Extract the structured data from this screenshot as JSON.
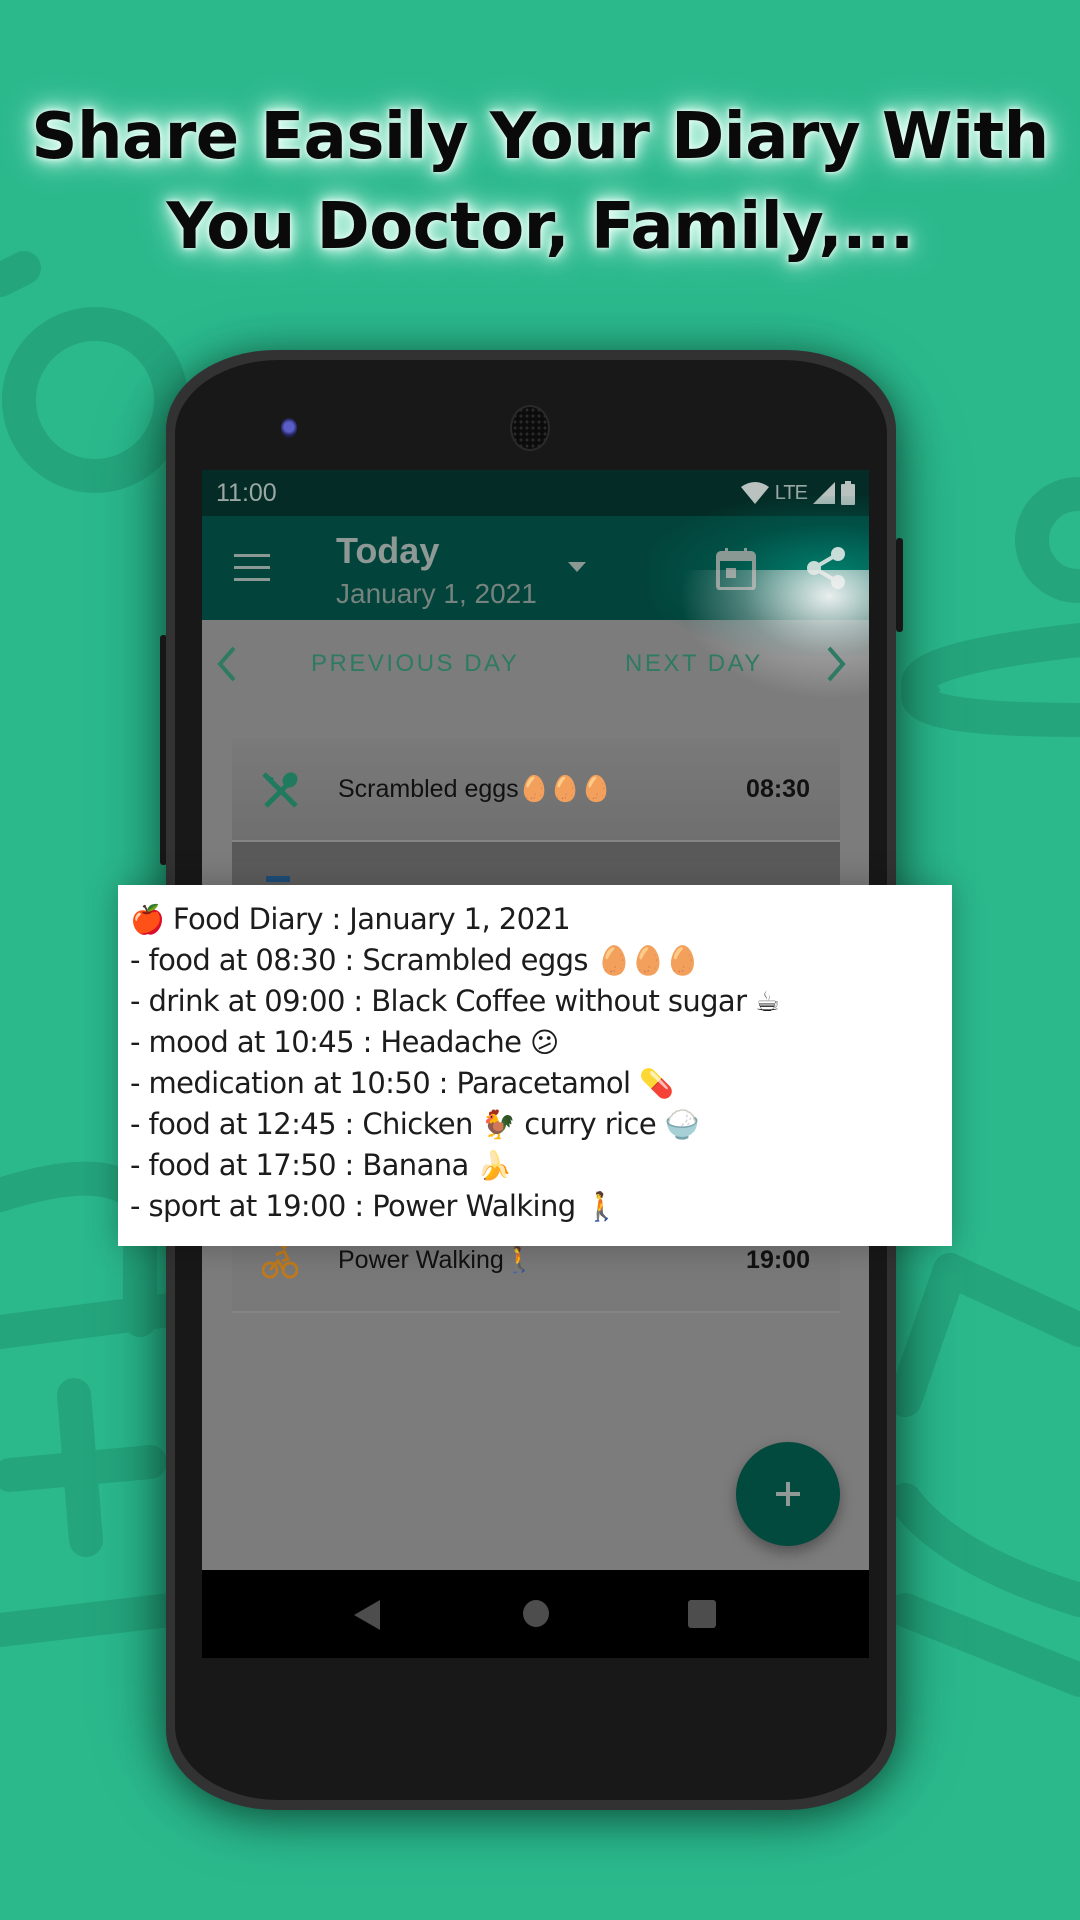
{
  "headline": {
    "line1": "Share Easily Your Diary With",
    "line2": "You Doctor, Family,..."
  },
  "colors": {
    "background": "#2bb98c",
    "app_bar": "#02443b",
    "status_bar": "#042b25",
    "accent_green": "#2e7a63",
    "sport_orange": "#c07a1c",
    "fab": "#024a3d"
  },
  "status_bar": {
    "time": "11:00",
    "network": "LTE",
    "icons": [
      "wifi-icon",
      "lte-signal-icon",
      "battery-icon"
    ]
  },
  "app_bar": {
    "menu_icon": "hamburger-menu-icon",
    "title": "Today",
    "subtitle": "January 1, 2021",
    "dropdown_icon": "dropdown-triangle-icon",
    "actions": [
      "calendar-icon",
      "share-icon"
    ]
  },
  "day_nav": {
    "previous_label": "PREVIOUS DAY",
    "next_label": "NEXT DAY"
  },
  "entries_visible": [
    {
      "icon": "fork-spoon-icon",
      "text": "Scrambled eggs🥚🥚🥚",
      "time": "08:30",
      "category": "food"
    },
    {
      "icon": "fork-spoon-icon",
      "text": "Banana 🍌",
      "time": "17:50",
      "category": "food"
    },
    {
      "icon": "bicycle-icon",
      "text": "Power Walking🚶",
      "time": "19:00",
      "category": "sport"
    }
  ],
  "fab": {
    "icon": "plus-icon"
  },
  "nav_bar": {
    "icons": [
      "back-icon",
      "home-icon",
      "recents-icon"
    ]
  },
  "shared_text": {
    "title_emoji": "🍎",
    "title": "Food Diary : January 1, 2021",
    "lines": [
      {
        "text": "- food at 08:30 : Scrambled eggs ",
        "emoji": "🥚🥚🥚"
      },
      {
        "text": "- drink at 09:00 : Black Coffee without sugar ",
        "emoji": "☕"
      },
      {
        "text": "- mood at 10:45 : Headache ",
        "emoji": "😕"
      },
      {
        "text": "- medication at 10:50 : Paracetamol ",
        "emoji": "💊"
      },
      {
        "text": "- food at 12:45 : Chicken ",
        "emoji": "🐓",
        "text2": " curry rice ",
        "emoji2": "🍚"
      },
      {
        "text": "- food at 17:50 : Banana ",
        "emoji": "🍌"
      },
      {
        "text": "- sport at 19:00 : Power Walking ",
        "emoji": "🚶"
      }
    ]
  }
}
